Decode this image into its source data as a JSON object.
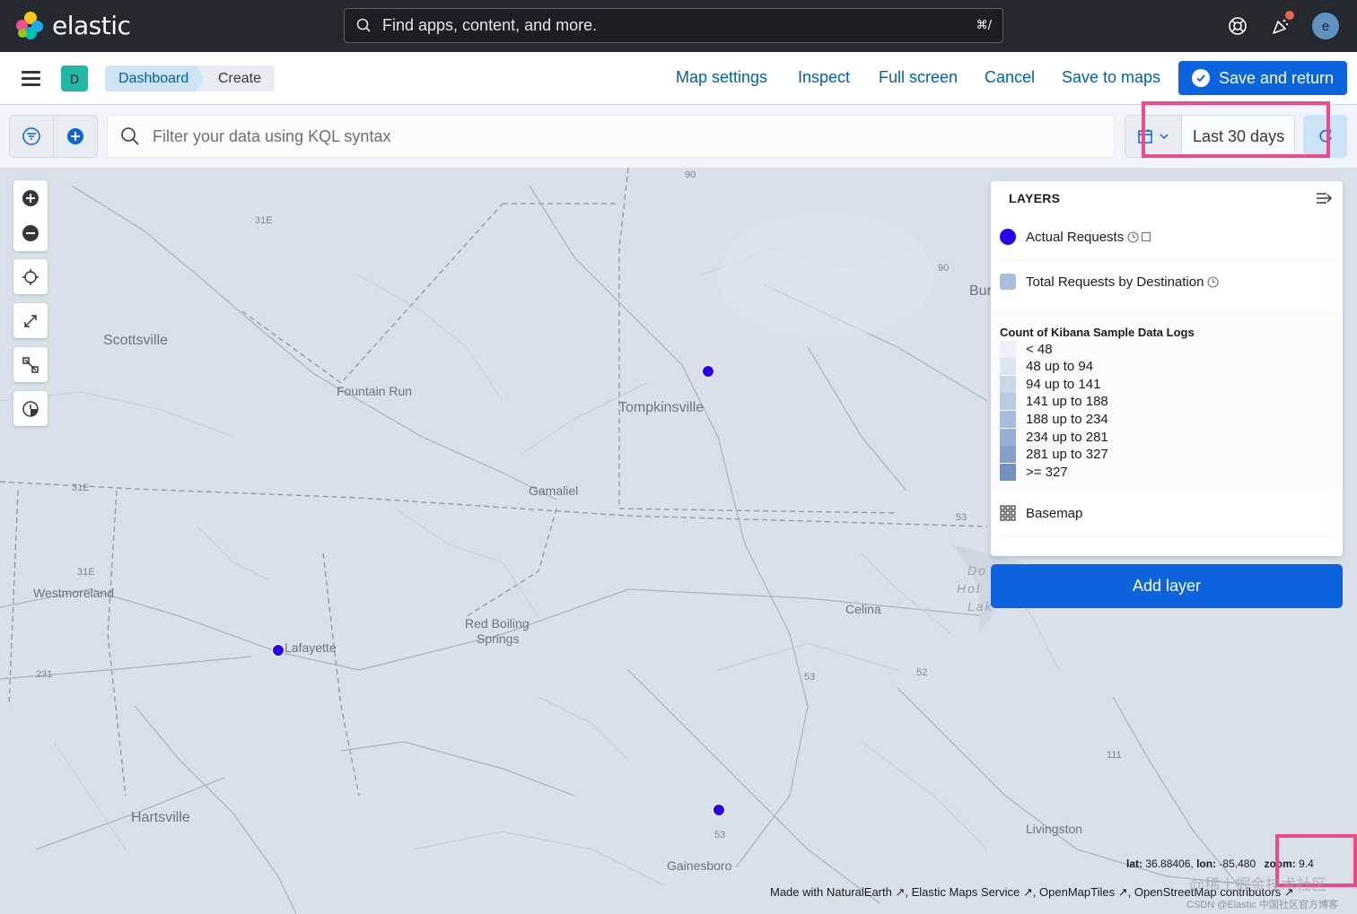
{
  "header": {
    "brand": "elastic",
    "search_placeholder": "Find apps, content, and more.",
    "search_shortcut": "⌘/",
    "avatar_initial": "e"
  },
  "navbar": {
    "space_initial": "D",
    "breadcrumbs": [
      "Dashboard",
      "Create"
    ],
    "links": [
      "Map settings",
      "Inspect",
      "Full screen",
      "Cancel",
      "Save to maps"
    ],
    "save_button": "Save and return"
  },
  "query": {
    "placeholder": "Filter your data using KQL syntax",
    "date_range": "Last 30 days"
  },
  "map": {
    "places": [
      "Scottsville",
      "Fountain Run",
      "Tompkinsville",
      "Gamaliel",
      "Westmoreland",
      "Red Boiling",
      "Springs",
      "Lafayette",
      "Celina",
      "Hartsville",
      "Livingston",
      "Gainesboro",
      "Bur",
      "Do",
      "Hol",
      "Lak"
    ],
    "roads": [
      "90",
      "31E",
      "90",
      "31E",
      "31E",
      "53",
      "231",
      "53",
      "52",
      "111",
      "53"
    ],
    "coords": {
      "lat_label": "lat:",
      "lat": "36.88406,",
      "lon_label": "lon:",
      "lon": "-85.480",
      "zoom_label": "zoom:",
      "zoom": "9.4"
    },
    "attribution": [
      "Made with NaturalEarth",
      "Elastic Maps Service",
      "OpenMapTiles",
      "OpenStreetMap contributors"
    ],
    "watermark": "CSDN @Elastic 中国社区官方博客",
    "watermark_overlay": "@稀土掘金技术社区"
  },
  "layers_panel": {
    "title": "LAYERS",
    "layers": [
      {
        "name": "Actual Requests",
        "color": "#2a00e8"
      },
      {
        "name": "Total Requests by Destination",
        "color": "#a8bfdc"
      }
    ],
    "legend_title": "Count of Kibana Sample Data Logs",
    "legend": [
      {
        "label": "< 48",
        "color": "#ecf1f7"
      },
      {
        "label": "48 up to 94",
        "color": "#dbe4f0"
      },
      {
        "label": "94 up to 141",
        "color": "#cad7e9"
      },
      {
        "label": "141 up to 188",
        "color": "#b9cae2"
      },
      {
        "label": "188 up to 234",
        "color": "#a7bcda"
      },
      {
        "label": "234 up to 281",
        "color": "#95aed1"
      },
      {
        "label": "281 up to 327",
        "color": "#83a0c8"
      },
      {
        "label": ">= 327",
        "color": "#6f92bf"
      }
    ],
    "basemap": "Basemap",
    "add_layer": "Add layer"
  },
  "colors": {
    "accent": "#0b64dd",
    "highlight": "#ee4a8b",
    "header_bg": "#25282f"
  }
}
